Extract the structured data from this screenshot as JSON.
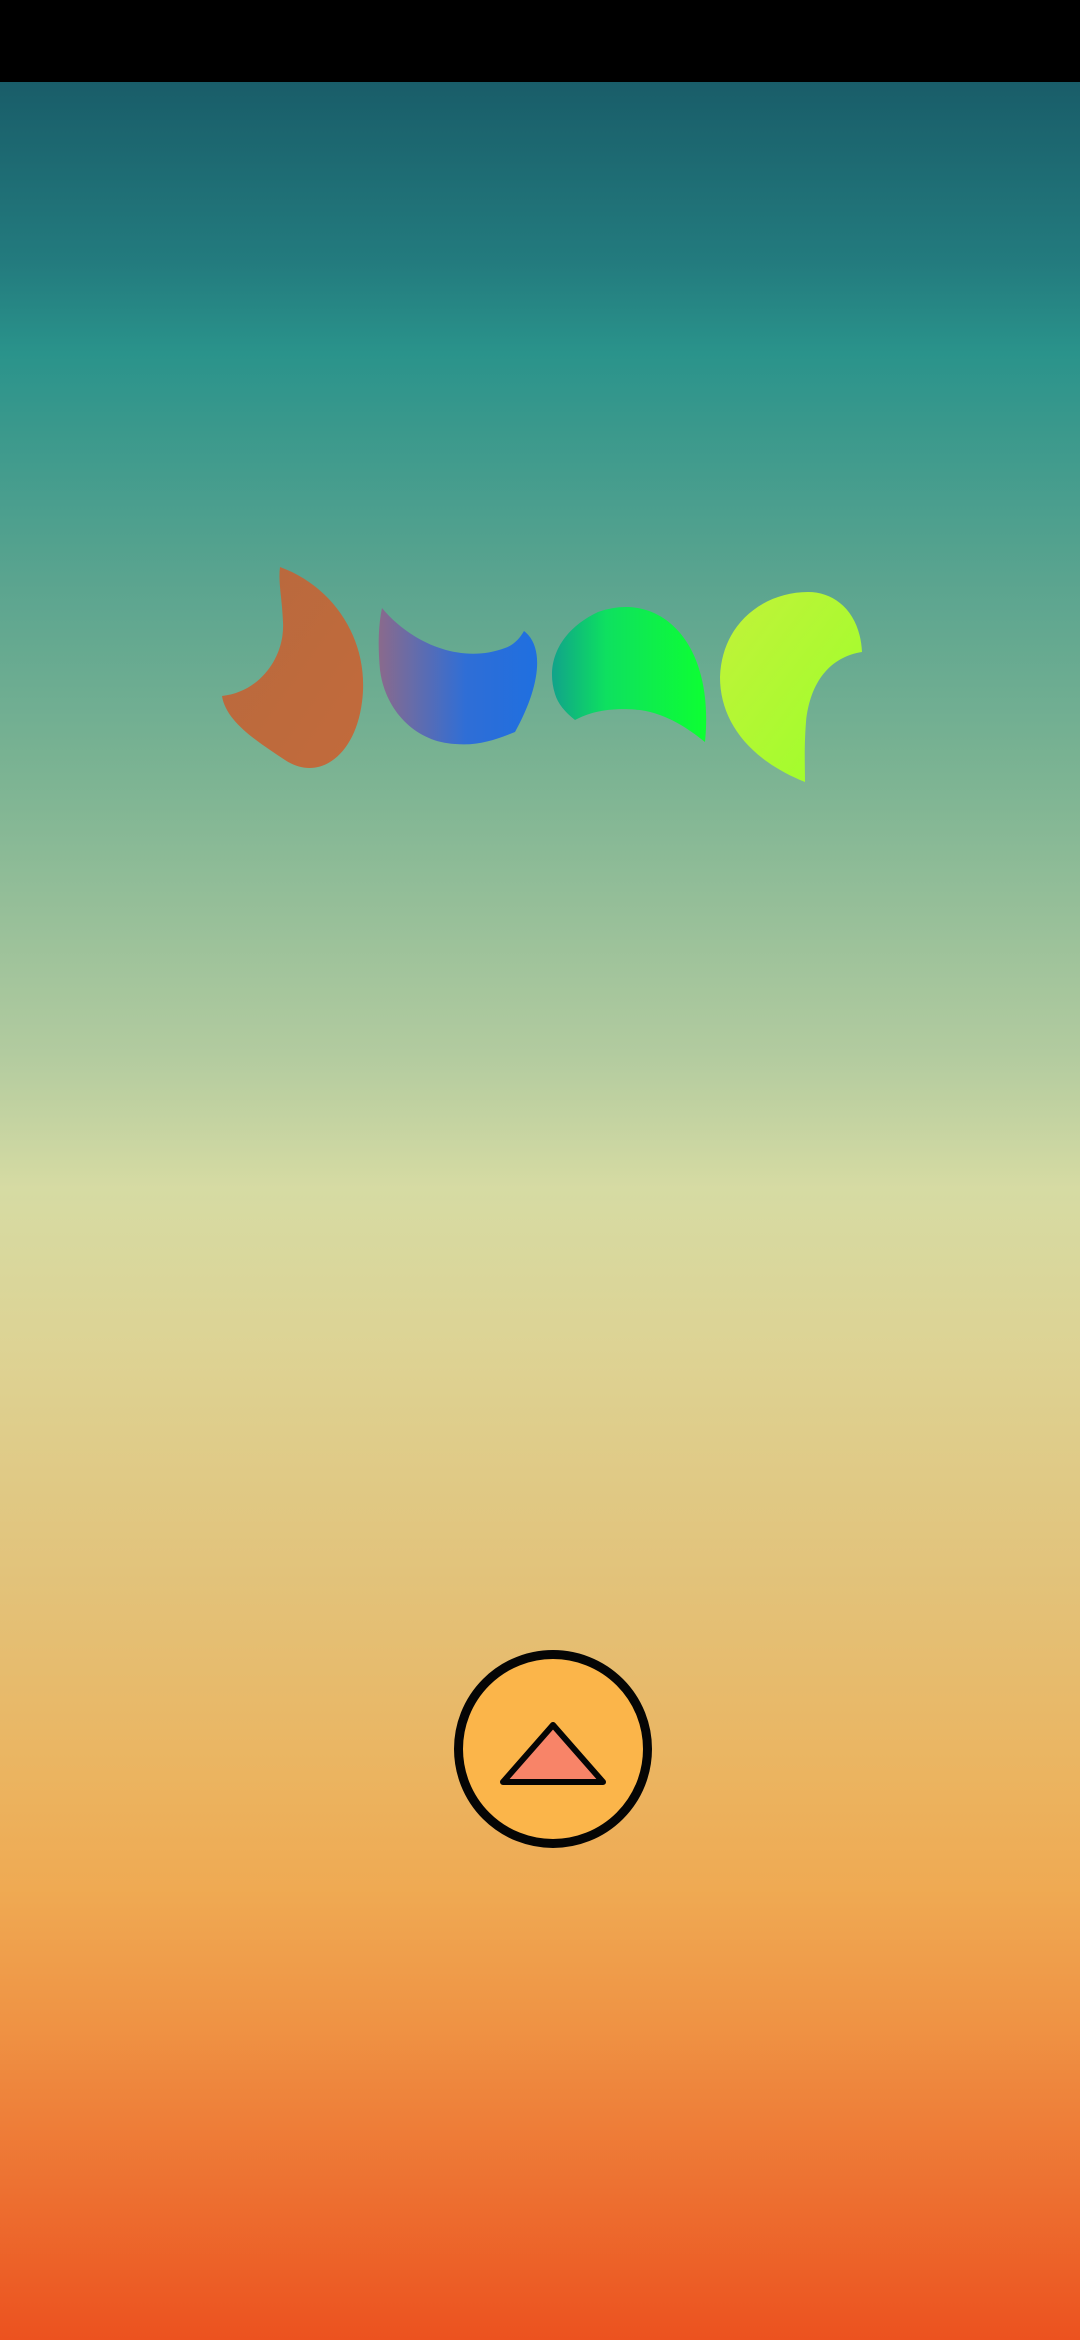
{
  "status_bar": {
    "color": "#000000"
  },
  "background": {
    "gradient_top": "#195d69",
    "gradient_mid": "#d6dba3",
    "gradient_bottom": "#ec521f"
  },
  "logo": {
    "shapes": [
      {
        "name": "crescent-orange",
        "colors": [
          "#b8693e",
          "#c26a3b"
        ]
      },
      {
        "name": "crescent-blue",
        "colors": [
          "#8a6a8c",
          "#1f6fe0"
        ]
      },
      {
        "name": "crescent-green",
        "colors": [
          "#10a38a",
          "#0dff32"
        ]
      },
      {
        "name": "crescent-lime",
        "colors": [
          "#c2f23a",
          "#9cff2a"
        ]
      }
    ]
  },
  "play_button": {
    "icon": "triangle-up-icon",
    "fill_color": "#fbb54a",
    "triangle_color": "#f88468",
    "border_color": "#050505"
  }
}
